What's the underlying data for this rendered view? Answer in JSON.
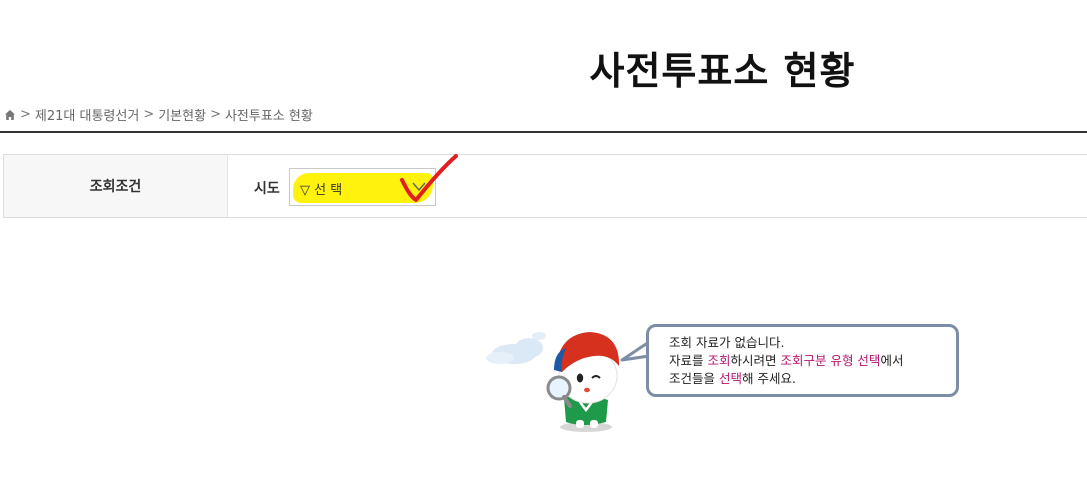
{
  "page": {
    "title": "사전투표소 현황"
  },
  "breadcrumb": {
    "items": [
      "제21대 대통령선거",
      "기본현황",
      "사전투표소 현황"
    ],
    "separator": ">"
  },
  "filter": {
    "header": "조회조건",
    "sido_label": "시도",
    "sido_select_value": "▽ 선 택"
  },
  "empty_state": {
    "line1": "조회 자료가 없습니다.",
    "line2_a": "자료를 ",
    "line2_b": "조회",
    "line2_c": "하시려면 ",
    "line2_d": "조회구분 유형 선택",
    "line2_e": "에서",
    "line3_a": "조건들을 ",
    "line3_b": "선택",
    "line3_c": "해 주세요."
  },
  "colors": {
    "highlight": "#fff200",
    "checkmark": "#e02020",
    "accent_text": "#b5166f",
    "bubble_border": "#7c8ea6"
  },
  "icons": [
    "home-icon",
    "chevron-down-icon",
    "checkmark-icon",
    "magnifier-icon"
  ]
}
